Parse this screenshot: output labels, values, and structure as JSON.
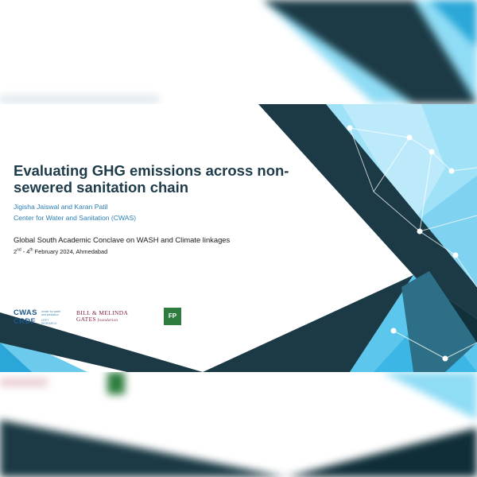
{
  "slide": {
    "title": "Evaluating GHG emissions across non-sewered sanitation chain",
    "authors": "Jigisha Jaiswal and Karan Patil",
    "organization": "Center for Water and Sanitation (CWAS)",
    "event": "Global South Academic Conclave on WASH and Climate linkages",
    "date": {
      "day_start": "2",
      "suffix_start": "nd",
      "separator": " - ",
      "day_end": "4",
      "suffix_end": "th",
      "rest": " February 2024, Ahmedabad"
    }
  },
  "logos": {
    "cwas": {
      "line1": "CWAS",
      "line2": "CRDF",
      "sub1": "center for water and sanitation",
      "sub2": "CEPT RESEARCH"
    },
    "gates": {
      "line1": "BILL & MELINDA",
      "line2": "GATES",
      "line2_suffix": " foundation"
    },
    "fp": {
      "text": "FP"
    }
  },
  "colors": {
    "title": "#1e3b4a",
    "author_text": "#2a7fb5",
    "dark_panel": "#1b3a45",
    "light_cyan": "#8fdcf5",
    "accent_blue": "#2aa7d8",
    "gates_maroon": "#7a1e3b",
    "fp_green": "#2e7d3e"
  }
}
